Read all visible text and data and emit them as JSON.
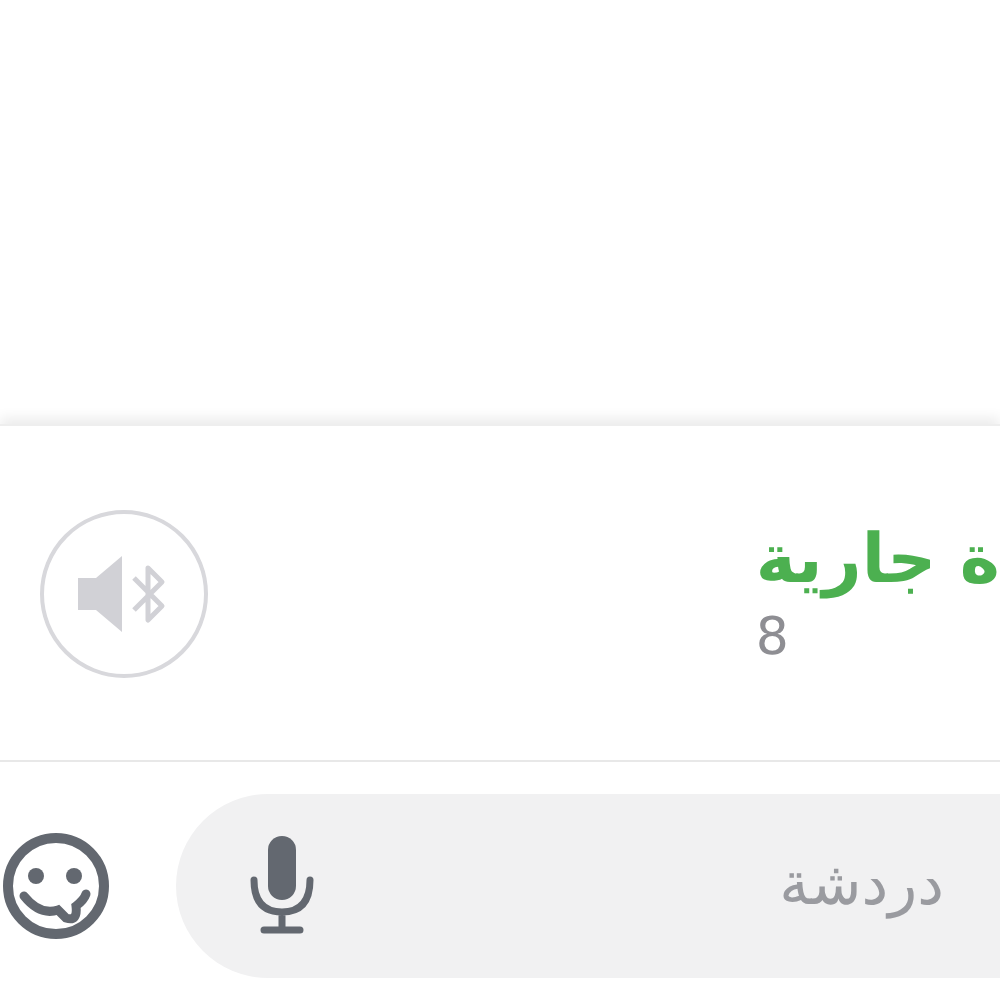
{
  "call": {
    "status": "ة جارية",
    "duration": "8"
  },
  "composer": {
    "placeholder": "دردشة"
  }
}
